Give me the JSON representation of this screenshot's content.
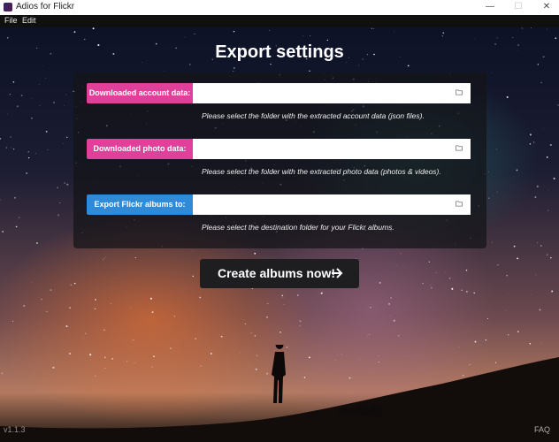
{
  "window": {
    "title": "Adios for Flickr",
    "minimize": "—",
    "maximize": "☐",
    "close": "✕"
  },
  "menu": {
    "items": [
      "File",
      "Edit"
    ]
  },
  "main": {
    "title": "Export settings"
  },
  "fields": [
    {
      "label": "Downloaded account data:",
      "value": "",
      "hint": "Please select the folder with the extracted account data (json files).",
      "color": "#e0409a"
    },
    {
      "label": "Downloaded photo data:",
      "value": "",
      "hint": "Please select the folder with the extracted photo data (photos & videos).",
      "color": "#e0409a"
    },
    {
      "label": "Export Flickr albums to:",
      "value": "",
      "hint": "Please select the destination folder for your Flickr albums.",
      "color": "#2f8ad8"
    }
  ],
  "action": {
    "label": "Create albums now!",
    "icon": "arrow-right-icon"
  },
  "footer": {
    "version": "v1.1.3",
    "faq": "FAQ"
  }
}
